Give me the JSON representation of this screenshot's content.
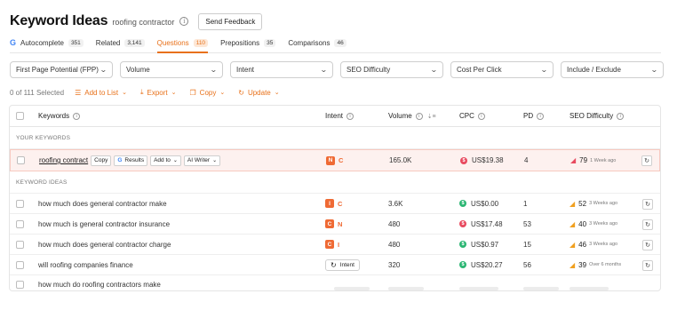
{
  "header": {
    "title": "Keyword Ideas",
    "subtitle": "roofing contractor",
    "feedback_label": "Send Feedback"
  },
  "tabs": [
    {
      "label": "Autocomplete",
      "count": "351",
      "google_glyph": "G"
    },
    {
      "label": "Related",
      "count": "3,141"
    },
    {
      "label": "Questions",
      "count": "110"
    },
    {
      "label": "Prepositions",
      "count": "35"
    },
    {
      "label": "Comparisons",
      "count": "46"
    }
  ],
  "filters": [
    "First Page Potential (FPP)",
    "Volume",
    "Intent",
    "SEO Difficulty",
    "Cost Per Click",
    "Include / Exclude"
  ],
  "actions": {
    "selected": "0 of 111 Selected",
    "add_to_list": "Add to List",
    "export": "Export",
    "copy": "Copy",
    "update": "Update"
  },
  "table": {
    "headers": {
      "keywords": "Keywords",
      "intent": "Intent",
      "volume": "Volume",
      "cpc": "CPC",
      "pd": "PD",
      "seo": "SEO Difficulty"
    },
    "section_your": "YOUR KEYWORDS",
    "section_ideas": "KEYWORD IDEAS",
    "main_row": {
      "keyword": "roofing contract",
      "copy_btn": "Copy",
      "results_btn": "Results",
      "add_to_btn": "Add to",
      "ai_writer_btn": "AI Writer",
      "intent_badge": "N",
      "intent_letter": "C",
      "volume": "165.0K",
      "cpc": "US$19.38",
      "pd": "4",
      "seo": "79",
      "ago": "1 Week ago"
    },
    "rows": [
      {
        "keyword": "how much does general contractor make",
        "intent_badge": "I",
        "intent_letter": "C",
        "volume": "3.6K",
        "cpc": "US$0.00",
        "pd": "1",
        "seo": "52",
        "ago": "3 Weeks ago"
      },
      {
        "keyword": "how much is general contractor insurance",
        "intent_badge": "C",
        "intent_letter": "N",
        "volume": "480",
        "cpc": "US$17.48",
        "pd": "53",
        "seo": "40",
        "ago": "3 Weeks ago"
      },
      {
        "keyword": "how much does general contractor charge",
        "intent_badge": "C",
        "intent_letter": "I",
        "volume": "480",
        "cpc": "US$0.97",
        "pd": "15",
        "seo": "46",
        "ago": "3 Weeks ago"
      },
      {
        "keyword": "will roofing companies finance",
        "intent_button": "Intent",
        "volume": "320",
        "cpc": "US$20.27",
        "pd": "56",
        "seo": "39",
        "ago": "Over 6 months"
      },
      {
        "keyword": "how much do roofing contractors make"
      }
    ]
  },
  "colors": {
    "accent": "#e8711a",
    "intent_badge": "#ef6a34",
    "cpc_green": "#2bb673",
    "cpc_red": "#e84a5f"
  },
  "icons": {
    "seo_high": "gauge-red-icon",
    "seo_mid": "gauge-orange-icon",
    "refresh": "refresh-icon"
  }
}
